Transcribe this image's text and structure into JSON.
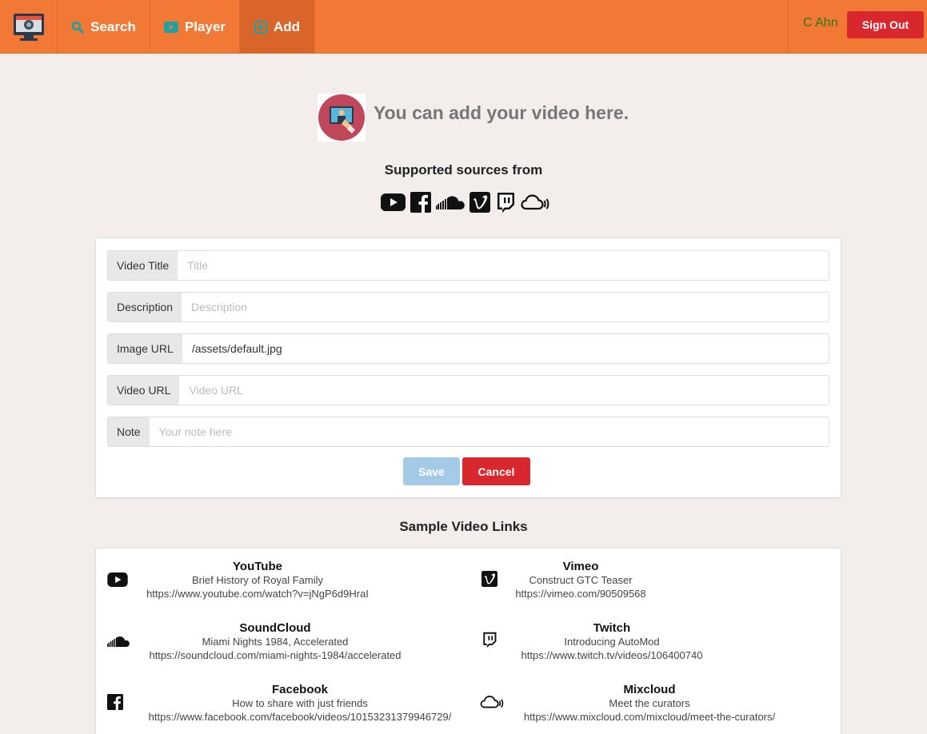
{
  "nav": {
    "search": "Search",
    "player": "Player",
    "add": "Add",
    "user": "C Ahn",
    "signout": "Sign Out"
  },
  "header": {
    "title": "You can add your video here.",
    "supported": "Supported sources from",
    "sources": [
      "youtube-icon",
      "facebook-icon",
      "soundcloud-icon",
      "vimeo-icon",
      "twitch-icon",
      "mixcloud-icon"
    ]
  },
  "form": {
    "fields": [
      {
        "label": "Video Title",
        "placeholder": "Title",
        "value": ""
      },
      {
        "label": "Description",
        "placeholder": "Description",
        "value": ""
      },
      {
        "label": "Image URL",
        "placeholder": "",
        "value": "/assets/default.jpg"
      },
      {
        "label": "Video URL",
        "placeholder": "Video URL",
        "value": ""
      },
      {
        "label": "Note",
        "placeholder": "Your note here",
        "value": ""
      }
    ],
    "save": "Save",
    "cancel": "Cancel"
  },
  "samples": {
    "title": "Sample Video Links",
    "items": [
      {
        "name": "YouTube",
        "desc": "Brief History of Royal Family",
        "url": "https://www.youtube.com/watch?v=jNgP6d9HraI"
      },
      {
        "name": "Vimeo",
        "desc": "Construct GTC Teaser",
        "url": "https://vimeo.com/90509568"
      },
      {
        "name": "SoundCloud",
        "desc": "Miami Nights 1984, Accelerated",
        "url": "https://soundcloud.com/miami-nights-1984/accelerated"
      },
      {
        "name": "Twitch",
        "desc": "Introducing AutoMod",
        "url": "https://www.twitch.tv/videos/106400740"
      },
      {
        "name": "Facebook",
        "desc": "How to share with just friends",
        "url": "https://www.facebook.com/facebook/videos/10153231379946729/"
      },
      {
        "name": "Mixcloud",
        "desc": "Meet the curators",
        "url": "https://www.mixcloud.com/mixcloud/meet-the-curators/"
      }
    ]
  },
  "colors": {
    "navbar": "#f27935",
    "danger": "#d9272e",
    "save_disabled": "#a3cbe8",
    "user": "#2c7a1a"
  }
}
